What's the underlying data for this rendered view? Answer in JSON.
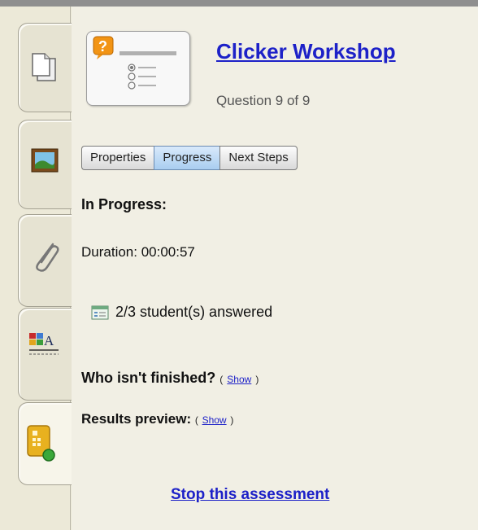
{
  "question": {
    "title": "Clicker Workshop",
    "subtitle": "Question 9 of 9"
  },
  "tabs": [
    {
      "label": "Properties"
    },
    {
      "label": "Progress"
    },
    {
      "label": "Next Steps"
    }
  ],
  "status": {
    "heading": "In Progress:",
    "duration": "Duration: 00:00:57",
    "answered": "2/3 student(s) answered"
  },
  "who_finished": {
    "label": "Who isn't finished?",
    "paren_open": "(",
    "link": "Show",
    "paren_close": ")"
  },
  "results_preview": {
    "label": "Results preview:",
    "paren_open": "(",
    "link": "Show",
    "paren_close": ")"
  },
  "stop_link": "Stop this assessment",
  "sidebar_icons": [
    "page-icon",
    "gallery-icon",
    "attachment-icon",
    "properties-icon",
    "response-icon"
  ]
}
